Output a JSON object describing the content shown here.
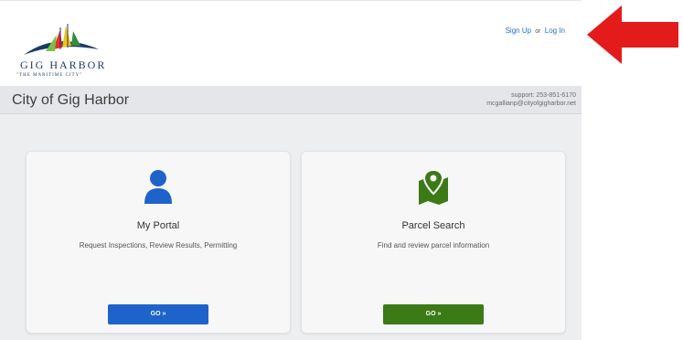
{
  "header": {
    "logo_name": "GIG HARBOR",
    "logo_tagline": "\"THE MARITIME CITY\"",
    "sign_up": "Sign Up",
    "or": "or",
    "log_in": "Log In"
  },
  "titlebar": {
    "city": "City of Gig Harbor",
    "support_phone": "support: 253-851-6170",
    "support_email": "mcgallianp@cityofgigharbor.net"
  },
  "cards": [
    {
      "title": "My Portal",
      "description": "Request Inspections, Review Results, Permitting",
      "button": "GO »",
      "icon": "user-icon",
      "color": "#1e63c9"
    },
    {
      "title": "Parcel Search",
      "description": "Find and review parcel information",
      "button": "GO »",
      "icon": "map-pin-icon",
      "color": "#3b7a17"
    }
  ],
  "annotation": {
    "icon": "red-arrow-icon",
    "color": "#e41b1b"
  }
}
